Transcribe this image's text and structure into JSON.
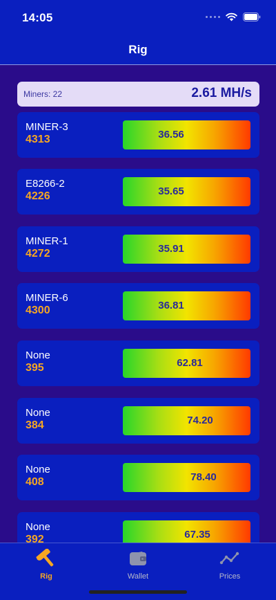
{
  "status_bar": {
    "time": "14:05"
  },
  "nav": {
    "title": "Rig"
  },
  "summary": {
    "miners_label": "Miners: 22",
    "hashrate": "2.61 MH/s"
  },
  "miners": [
    {
      "name": "MINER-3",
      "id": "4313",
      "value": "36.56"
    },
    {
      "name": "E8266-2",
      "id": "4226",
      "value": "35.65"
    },
    {
      "name": "MINER-1",
      "id": "4272",
      "value": "35.91"
    },
    {
      "name": "MINER-6",
      "id": "4300",
      "value": "36.81"
    },
    {
      "name": "None",
      "id": "395",
      "value": "62.81"
    },
    {
      "name": "None",
      "id": "384",
      "value": "74.20"
    },
    {
      "name": "None",
      "id": "408",
      "value": "78.40"
    },
    {
      "name": "None",
      "id": "392",
      "value": "67.35"
    }
  ],
  "tabs": [
    {
      "label": "Rig",
      "icon": "hammer-icon",
      "active": true
    },
    {
      "label": "Wallet",
      "icon": "wallet-icon",
      "active": false
    },
    {
      "label": "Prices",
      "icon": "chart-line-icon",
      "active": false
    }
  ],
  "colors": {
    "header_bg": "#0a1fbf",
    "page_bg": "#2a0c8a",
    "accent": "#f5a623",
    "summary_bg": "#e4dcf7",
    "gauge_start": "#28d62a",
    "gauge_mid": "#f2e400",
    "gauge_end": "#ff3a00"
  }
}
